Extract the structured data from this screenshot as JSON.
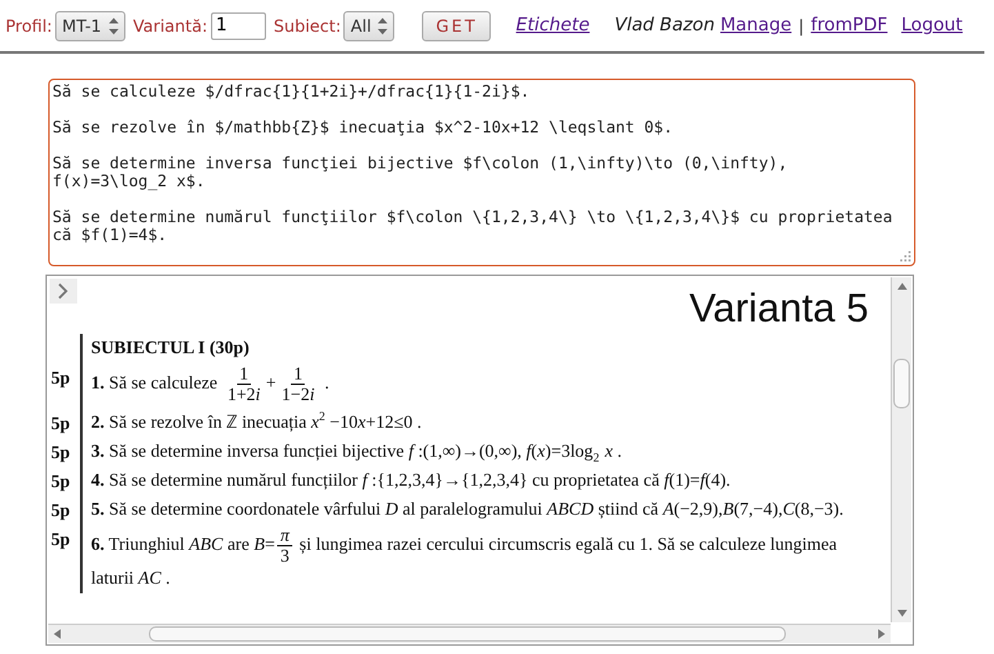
{
  "toolbar": {
    "profil": {
      "label": "Profil:",
      "value": "MT-1"
    },
    "varianta": {
      "label": "Variantă:",
      "value": "1"
    },
    "subiect": {
      "label": "Subiect:",
      "value": "All"
    },
    "get_button": "GET",
    "etichete_link": "Etichete",
    "user": "Vlad Bazon",
    "links": [
      "Manage",
      "fromPDF",
      "Logout"
    ],
    "separator": "|"
  },
  "editor": {
    "value": "Să se calculeze $/dfrac{1}{1+2i}+/dfrac{1}{1-2i}$.\n\nSă se rezolve în $/mathbb{Z}$ inecuaţia $x^2-10x+12 \\leqslant 0$.\n\nSă se determine inversa funcţiei bijective $f\\colon (1,\\infty)\\to (0,\\infty),\nf(x)=3\\log_2 x$.\n\nSă se determine numărul funcţiilor $f\\colon \\{1,2,3,4\\} \\to \\{1,2,3,4\\}$ cu proprietatea\ncă $f(1)=4$."
  },
  "document": {
    "title": "Varianta 5",
    "section": "SUBIECTUL I (30p)",
    "items": [
      {
        "points": "5p",
        "number": "1.",
        "segments": [
          {
            "kind": "text",
            "text": " Să se calculeze "
          },
          {
            "kind": "frac",
            "num": [
              {
                "kind": "text",
                "text": "1"
              }
            ],
            "den": [
              {
                "kind": "text",
                "text": "1+2"
              },
              {
                "kind": "var",
                "text": "i"
              }
            ]
          },
          {
            "kind": "text",
            "text": "+"
          },
          {
            "kind": "frac",
            "num": [
              {
                "kind": "text",
                "text": "1"
              }
            ],
            "den": [
              {
                "kind": "text",
                "text": "1−2"
              },
              {
                "kind": "var",
                "text": "i"
              }
            ]
          },
          {
            "kind": "text",
            "text": " ."
          }
        ]
      },
      {
        "points": "5p",
        "number": "2.",
        "segments": [
          {
            "kind": "text",
            "text": " Să se rezolve în ℤ inecuația "
          },
          {
            "kind": "var",
            "text": "x"
          },
          {
            "kind": "sup",
            "text": "2"
          },
          {
            "kind": "text",
            "text": " −10"
          },
          {
            "kind": "var",
            "text": "x"
          },
          {
            "kind": "text",
            "text": "+12≤0 ."
          }
        ]
      },
      {
        "points": "5p",
        "number": "3.",
        "segments": [
          {
            "kind": "text",
            "text": " Să se determine inversa funcției bijective "
          },
          {
            "kind": "var",
            "text": "f"
          },
          {
            "kind": "text",
            "text": " :(1,∞)→(0,∞), "
          },
          {
            "kind": "var",
            "text": "f"
          },
          {
            "kind": "text",
            "text": "("
          },
          {
            "kind": "var",
            "text": "x"
          },
          {
            "kind": "text",
            "text": ")=3log"
          },
          {
            "kind": "sub",
            "text": "2"
          },
          {
            "kind": "var",
            "text": "x"
          },
          {
            "kind": "text",
            "text": " ."
          }
        ]
      },
      {
        "points": "5p",
        "number": "4.",
        "segments": [
          {
            "kind": "text",
            "text": " Să se determine numărul funcțiilor "
          },
          {
            "kind": "var",
            "text": "f"
          },
          {
            "kind": "text",
            "text": " :{1,2,3,4}→{1,2,3,4} cu proprietatea că "
          },
          {
            "kind": "var",
            "text": "f"
          },
          {
            "kind": "text",
            "text": "(1)="
          },
          {
            "kind": "var",
            "text": "f"
          },
          {
            "kind": "text",
            "text": "(4)."
          }
        ]
      },
      {
        "points": "5p",
        "number": "5.",
        "segments": [
          {
            "kind": "text",
            "text": " Să se determine coordonatele vârfului "
          },
          {
            "kind": "var",
            "text": "D"
          },
          {
            "kind": "text",
            "text": " al paralelogramului "
          },
          {
            "kind": "var",
            "text": "ABCD"
          },
          {
            "kind": "text",
            "text": " știind că "
          },
          {
            "kind": "var",
            "text": "A"
          },
          {
            "kind": "text",
            "text": "(−2,9),"
          },
          {
            "kind": "var",
            "text": "B"
          },
          {
            "kind": "text",
            "text": "(7,−4),"
          },
          {
            "kind": "var",
            "text": "C"
          },
          {
            "kind": "text",
            "text": "(8,−3)."
          }
        ]
      },
      {
        "points": "5p",
        "number": "6.",
        "segments": [
          {
            "kind": "text",
            "text": " Triunghiul "
          },
          {
            "kind": "var",
            "text": "ABC"
          },
          {
            "kind": "text",
            "text": " are "
          },
          {
            "kind": "var",
            "text": "B"
          },
          {
            "kind": "text",
            "text": "="
          },
          {
            "kind": "frac",
            "num": [
              {
                "kind": "var",
                "text": "π"
              }
            ],
            "den": [
              {
                "kind": "text",
                "text": "3"
              }
            ]
          },
          {
            "kind": "text",
            "text": " și lungimea razei cercului circumscris egală cu 1. Să se calculeze lungimea laturii "
          },
          {
            "kind": "var",
            "text": "AC"
          },
          {
            "kind": "text",
            "text": " ."
          }
        ]
      }
    ]
  }
}
